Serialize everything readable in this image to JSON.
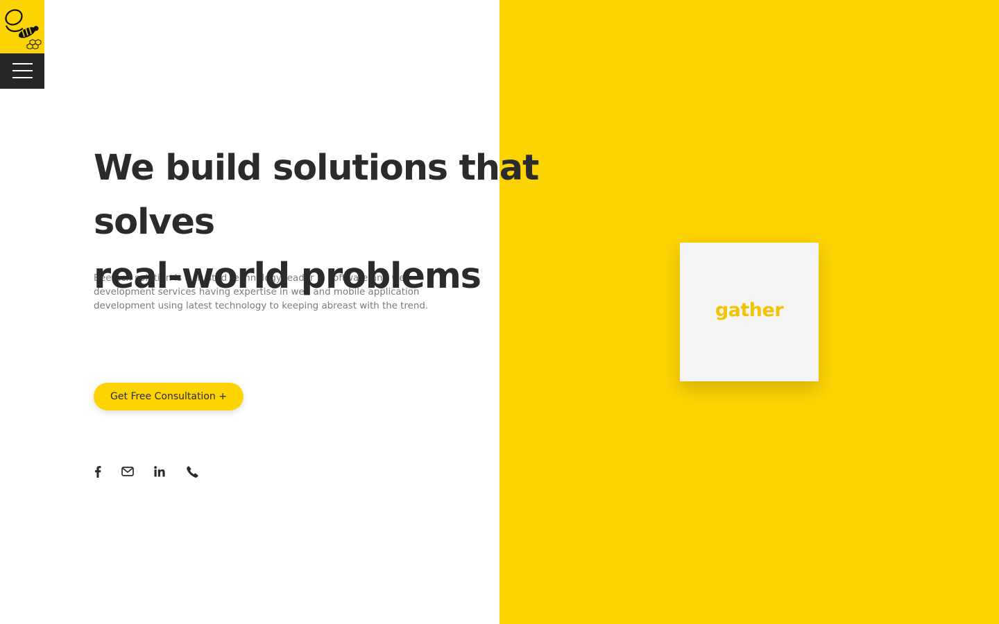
{
  "brand": {
    "logo_icon": "bee-logo-icon",
    "accent_color": "#fcd303",
    "dark_color": "#262626"
  },
  "nav": {
    "menu_icon": "hamburger-menu-icon"
  },
  "hero": {
    "headline_line1": "We build solutions that solves",
    "headline_line2": "real-world problems",
    "description": "Beetech solution is a trusted technology leader in software and web development services having expertise in web and mobile application development using latest technology to keeping abreast with the trend.",
    "cta_label": "Get Free Consultation +"
  },
  "socials": [
    {
      "icon": "facebook-icon"
    },
    {
      "icon": "email-icon"
    },
    {
      "icon": "linkedin-icon"
    },
    {
      "icon": "phone-icon"
    }
  ],
  "word_card": {
    "word": "gather"
  }
}
